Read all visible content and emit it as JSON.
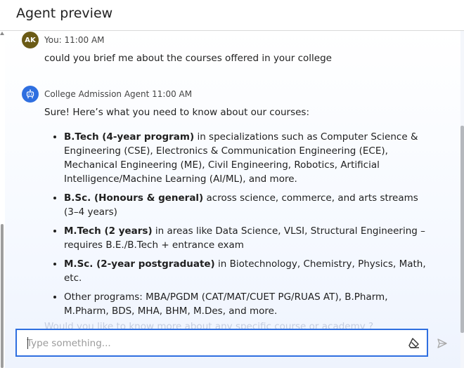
{
  "header": {
    "title": "Agent preview"
  },
  "messages": {
    "user": {
      "avatar_initials": "AK",
      "meta": "You: 11:00 AM",
      "text": "could you brief me about the courses offered in your college"
    },
    "agent": {
      "meta": "College Admission Agent 11:00 AM",
      "intro": "Sure! Here’s what you need to know about our courses:",
      "courses": [
        {
          "bold": "B.Tech (4-year program)",
          "rest": " in specializations such as Computer Science & Engineering (CSE), Electronics & Communication Engineering (ECE), Mechanical Engineering (ME), Civil Engineering, Robotics, Artificial Intelligence/Machine Learning (AI/ML), and more."
        },
        {
          "bold": "B.Sc. (Honours & general)",
          "rest": " across science, commerce, and arts streams (3–4 years)"
        },
        {
          "bold": "M.Tech (2 years)",
          "rest": " in areas like Data Science, VLSI, Structural Engineering – requires B.E./B.Tech + entrance exam"
        },
        {
          "bold": "M.Sc. (2-year postgraduate)",
          "rest": " in Biotechnology, Chemistry, Physics, Math, etc."
        },
        {
          "bold": "",
          "rest": "Other programs: MBA/PGDM (CAT/MAT/CUET PG/RUAS AT), B.Pharm, M.Pharm, BDS, MHA, BHM, M.Des, and more."
        }
      ],
      "faded_followup": "Would you like to know more about any specific course or academy ?"
    }
  },
  "composer": {
    "placeholder": "Type something...",
    "value": ""
  },
  "icons": {
    "agent_avatar": "robot-icon",
    "clear": "eraser-icon",
    "send": "send-icon"
  },
  "colors": {
    "accent": "#2f6fe0",
    "user_avatar": "#6b5b16"
  }
}
